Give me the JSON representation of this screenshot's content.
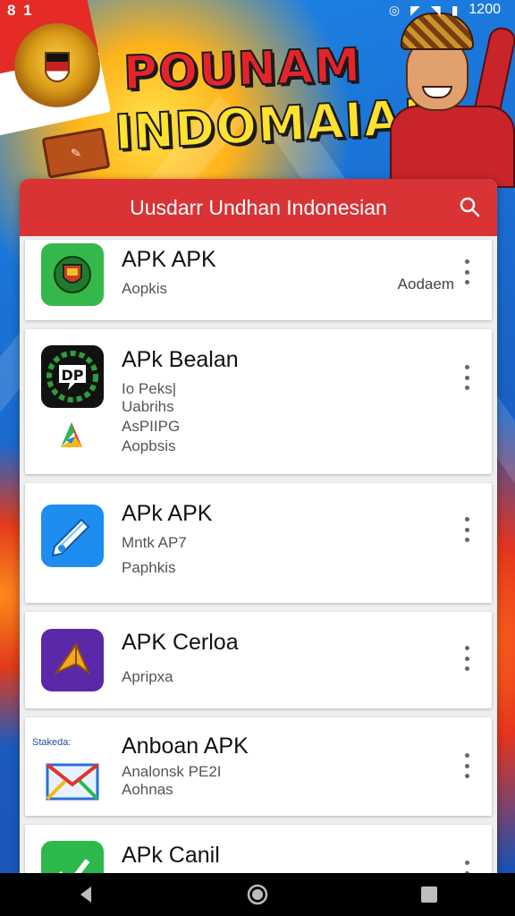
{
  "status_bar": {
    "left_text": "8 1",
    "time": "1200"
  },
  "banner": {
    "title_line1": "POUNAM",
    "title_line2": "INDOMAIA!"
  },
  "toolbar": {
    "title": "Uusdarr Undhan Indonesian",
    "search_icon": "search-icon",
    "color": "#d93336"
  },
  "apps": [
    {
      "name": "APK APK",
      "sub_lines": [
        "Aopkis"
      ],
      "right_label": "Aodaem",
      "icon": "shield-emblem-icon",
      "icon_color": "#35b84a"
    },
    {
      "name": "APk Bealan",
      "sub_lines": [
        "Io Peks|",
        "Uabrihs",
        "AsPIIPG",
        "Aopbsis"
      ],
      "right_label": "",
      "icon": "dp-logo-icon",
      "icon_color": "#111111"
    },
    {
      "name": "APk APK",
      "sub_lines": [
        "Mntk AP7",
        "Paphkis"
      ],
      "right_label": "",
      "icon": "pencil-icon",
      "icon_color": "#1e8df0"
    },
    {
      "name": "APK Cerloa",
      "sub_lines": [
        "Apripxa"
      ],
      "right_label": "",
      "icon": "paper-plane-icon",
      "icon_color": "#5a28a8"
    },
    {
      "name": "Anboan APK",
      "sub_lines": [
        "Analonsk PE2I",
        "Aohnas"
      ],
      "right_label": "",
      "icon": "mail-icon",
      "icon_color": "#ffffff",
      "icon_caption": "Stakeda:"
    },
    {
      "name": "APk Canil",
      "sub_lines": [],
      "right_label": "",
      "icon": "check-icon",
      "icon_color": "#2cb84a"
    }
  ],
  "navbar": {
    "back": "back-icon",
    "home": "home-icon",
    "recents": "recents-icon"
  }
}
